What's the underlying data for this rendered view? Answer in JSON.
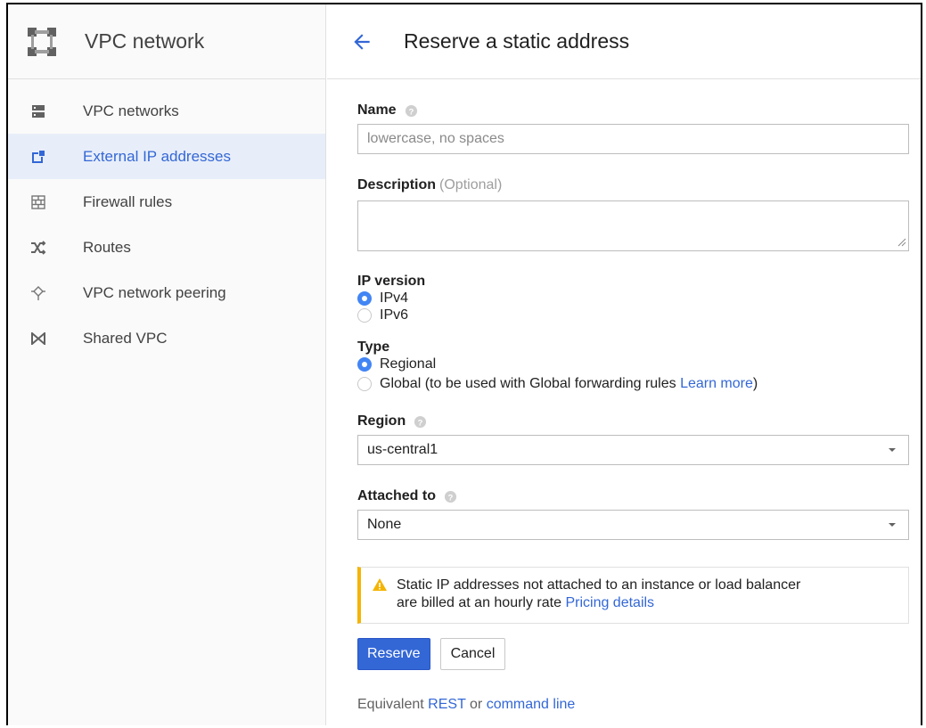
{
  "sidebar": {
    "product_title": "VPC network",
    "logo_icon": "vpc-network-logo-icon",
    "items": [
      {
        "label": "VPC networks",
        "icon": "vpc-networks-icon",
        "active": false
      },
      {
        "label": "External IP addresses",
        "icon": "external-ip-icon",
        "active": true
      },
      {
        "label": "Firewall rules",
        "icon": "firewall-icon",
        "active": false
      },
      {
        "label": "Routes",
        "icon": "routes-icon",
        "active": false
      },
      {
        "label": "VPC network peering",
        "icon": "peering-icon",
        "active": false
      },
      {
        "label": "Shared VPC",
        "icon": "shared-vpc-icon",
        "active": false
      }
    ]
  },
  "header": {
    "back_icon": "back-arrow-icon",
    "title": "Reserve a static address"
  },
  "form": {
    "name": {
      "label": "Name",
      "placeholder": "lowercase, no spaces",
      "value": ""
    },
    "description": {
      "label": "Description",
      "optional": "(Optional)",
      "value": ""
    },
    "ip_version": {
      "label": "IP version",
      "options": [
        {
          "label": "IPv4",
          "checked": true
        },
        {
          "label": "IPv6",
          "checked": false
        }
      ]
    },
    "type": {
      "label": "Type",
      "options": [
        {
          "label": "Regional",
          "checked": true
        },
        {
          "label": "Global (to be used with Global forwarding rules ",
          "link": "Learn more",
          "suffix": ")",
          "checked": false
        }
      ]
    },
    "region": {
      "label": "Region",
      "value": "us-central1"
    },
    "attached_to": {
      "label": "Attached to",
      "value": "None"
    }
  },
  "warning": {
    "line1": "Static IP addresses not attached to an instance or load balancer",
    "line2": "are billed at an hourly rate ",
    "link": "Pricing details"
  },
  "buttons": {
    "reserve": "Reserve",
    "cancel": "Cancel"
  },
  "equivalent": {
    "prefix": "Equivalent ",
    "rest": "REST",
    "or": " or ",
    "command_line": "command line"
  },
  "colors": {
    "accent": "#3367d6",
    "radio_checked": "#4285f4",
    "warning": "#f4b400",
    "active_bg": "#e8eef9"
  }
}
